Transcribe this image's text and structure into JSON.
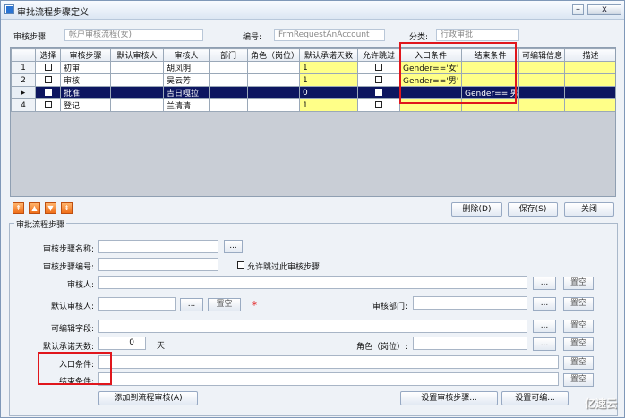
{
  "window": {
    "title": "审批流程步骤定义",
    "controls": {
      "minimize": "–",
      "close": "x"
    }
  },
  "header": {
    "step_label": "审核步骤:",
    "step_value": "帐户审核流程(女)",
    "code_label": "编号:",
    "code_value": "FrmRequestAnAccount",
    "category_label": "分类:",
    "category_value": "行政审批"
  },
  "grid": {
    "columns": [
      "",
      "选择",
      "审核步骤",
      "默认审核人",
      "审核人",
      "部门",
      "角色（岗位）",
      "默认承诺天数",
      "允许跳过",
      "入口条件",
      "结束条件",
      "可编辑信息",
      "描述"
    ],
    "rows": [
      {
        "num": "1",
        "step": "初审",
        "approver": "胡凤明",
        "days": "1",
        "entry": "Gender=='女'",
        "end": ""
      },
      {
        "num": "2",
        "step": "审核",
        "approver": "吴云芳",
        "days": "1",
        "entry": "Gender=='男'",
        "end": ""
      },
      {
        "num": "▸",
        "step": "批准",
        "approver": "吉日嘎拉",
        "days": "0",
        "entry": "",
        "end": "Gender=='男'"
      },
      {
        "num": "4",
        "step": "登记",
        "approver": "兰清清",
        "days": "1",
        "entry": "",
        "end": ""
      }
    ]
  },
  "toolbar": {
    "top": "⇞",
    "up": "▲",
    "down": "▼",
    "bottom": "⇟",
    "delete": "删除(D)",
    "save": "保存(S)",
    "close": "关闭"
  },
  "form": {
    "group_title": "审批流程步骤",
    "step_name": "审核步骤名称:",
    "step_code": "审核步骤编号:",
    "allow_skip": "允许跳过此审核步骤",
    "approver": "审核人:",
    "default_approver": "默认审核人:",
    "department": "审核部门:",
    "editable_fields": "可编辑字段:",
    "default_days": "默认承诺天数:",
    "days_value": "0",
    "days_unit": "天",
    "role": "角色（岗位）:",
    "entry_condition": "入口条件:",
    "end_condition": "结束条件:",
    "ellipsis": "...",
    "clear": "置空",
    "add": "添加到流程审核(A)",
    "set_steps": "设置审核步骤...",
    "set_editable": "设置可编..."
  },
  "watermark": "亿速云",
  "colors": {
    "selected_row": "#0d1660",
    "highlight": "#ffff88",
    "annotation": "#e0161c"
  }
}
